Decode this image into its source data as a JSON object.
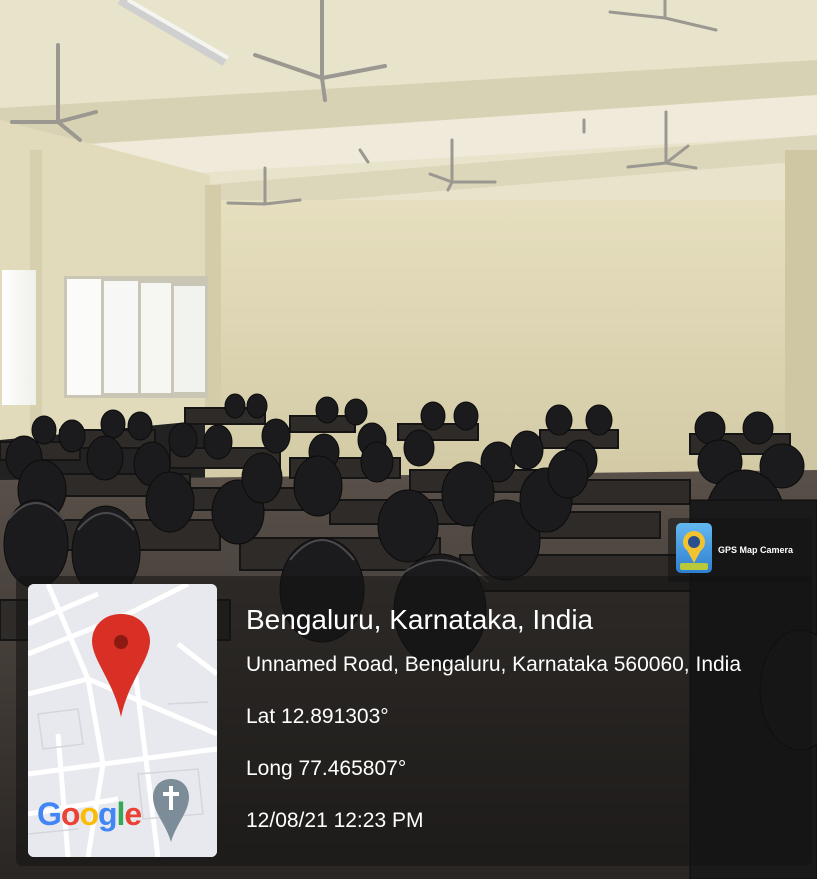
{
  "location": {
    "title": "Bengaluru, Karnataka, India",
    "address": "Unnamed Road, Bengaluru, Karnataka 560060, India",
    "latitude": "Lat 12.891303°",
    "longitude": "Long 77.465807°",
    "datetime": "12/08/21 12:23 PM"
  },
  "app_badge": {
    "label": "GPS Map Camera",
    "icon": "map-pin-camera-icon"
  },
  "map_thumbnail": {
    "brand": "Google",
    "pin_icon": "location-pin-icon",
    "landmark_icon": "church-cross-icon",
    "pin_color": "#d93025"
  },
  "scene": {
    "colors": {
      "wall": "#ddd5b4",
      "ceiling": "#e7e2c9",
      "floor": "#3e3a35",
      "chairs": "#1c1c1e",
      "desks": "#2e2b28"
    }
  }
}
